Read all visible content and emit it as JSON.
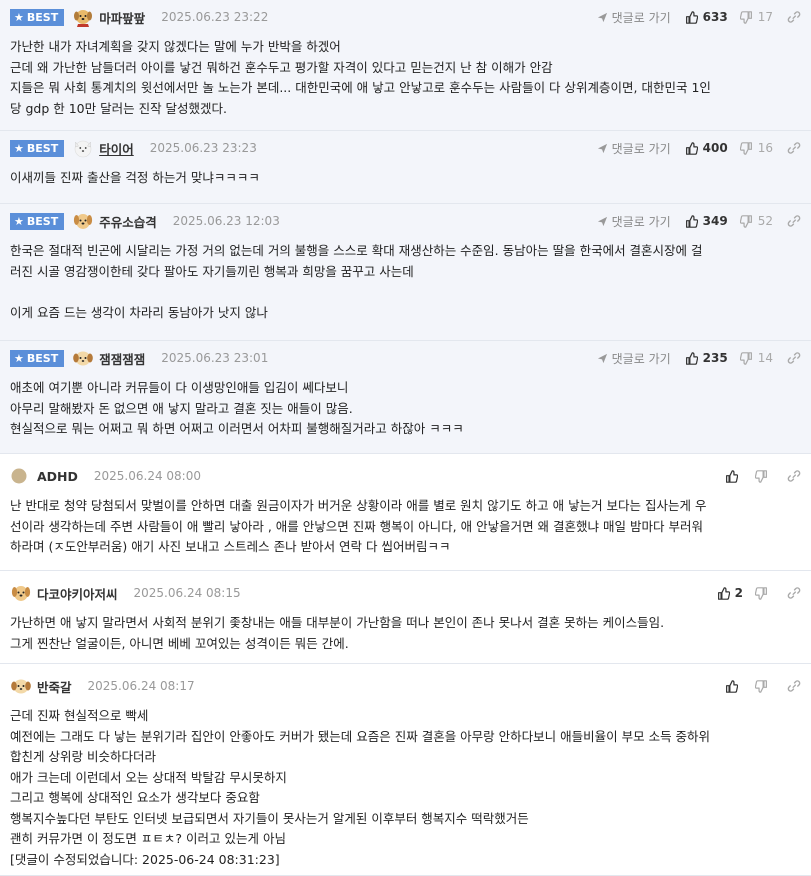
{
  "labels": {
    "best": "BEST",
    "reply": "댓글로 가기"
  },
  "comments": [
    {
      "best": true,
      "avatar": "puppy-santa-avatar",
      "nick": "마파팦팦",
      "date": "2025.06.23 23:22",
      "up": "633",
      "down": "17",
      "lines": [
        "가난한 내가 자녀계획을 갖지 않겠다는 말에 누가 반박을 하겠어",
        "근데 왜 가난한 남들더러 아이를 낳건 뭐하건 훈수두고 평가할 자격이 있다고 믿는건지 난 참 이해가 안감",
        "지들은 뭐 사회 통계치의 윗선에서만 놀 노는가 본데... 대한민국에 애 낳고 안낳고로 훈수두는 사람들이 다 상위계층이면, 대한민국 1인",
        "당 gdp 한 10만 달러는 진작 달성했겠다."
      ]
    },
    {
      "best": true,
      "avatar": "white-dog-avatar",
      "nick": "타이어",
      "date": "2025.06.23 23:23",
      "up": "400",
      "down": "16",
      "lines": [
        "이새끼들 진짜 출산을 걱정 하는거 맞냐ㅋㅋㅋㅋ"
      ]
    },
    {
      "best": true,
      "avatar": "puppy-avatar",
      "nick": "주유소습격",
      "date": "2025.06.23 12:03",
      "up": "349",
      "down": "52",
      "lines": [
        "한국은 절대적 빈곤에 시달리는 가정 거의 없는데 거의 불행을 스스로 확대 재생산하는 수준임. 동남아는 딸을 한국에서 결혼시장에 걸",
        "러진 시골 영감쟁이한테 갖다 팔아도 자기들끼린 행복과 희망을 꿈꾸고 사는데",
        "",
        "이게 요즘 드는 생각이 차라리 동남아가 낫지 않나"
      ]
    },
    {
      "best": true,
      "avatar": "puppy-face-avatar",
      "nick": "잼잼잼잼",
      "date": "2025.06.23 23:01",
      "up": "235",
      "down": "14",
      "lines": [
        "애초에 여기뿐 아니라 커뮤들이 다 이생망인애들 입김이 쎄다보니",
        "아무리 말해봤자 돈 없으면 애 낳지 말라고 결혼 짓는 애들이 많음.",
        "현실적으로 뭐는 어쩌고 뭐 하면 어쩌고 이러면서 어차피 불행해질거라고 하잖아 ㅋㅋㅋ"
      ]
    },
    {
      "best": false,
      "avatar": "default-circle-avatar",
      "nick": "ADHD",
      "date": "2025.06.24 08:00",
      "up": "",
      "down": "",
      "lines": [
        "난 반대로 청약 당첨되서 맞벌이를 안하면 대출 원금이자가 버거운 상황이라 애를 별로 원치 않기도 하고 애 낳는거 보다는 집사는게 우",
        "선이라 생각하는데 주변 사람들이 애 빨리 낳아라 , 애를 안낳으면 진짜 행복이 아니다, 애 안낳을거면 왜 결혼했냐 매일 밤마다 부러워",
        "하라며 (ㅈ도안부러움) 애기 사진 보내고 스트레스 존나 받아서 연락 다 씹어버림ㅋㅋ"
      ]
    },
    {
      "best": false,
      "avatar": "puppy-avatar",
      "nick": "다코야키아저씨",
      "date": "2025.06.24 08:15",
      "up": "2",
      "down": "",
      "lines": [
        "가난하면 애 낳지 말라면서 사회적 분위기 좇창내는 애들 대부분이 가난함을 떠나 본인이 존나 못나서 결혼 못하는 케이스들임.",
        "그게 찐찬난 얼굴이든, 아니면 베베 꼬여있는 성격이든 뭐든 간에."
      ]
    },
    {
      "best": false,
      "avatar": "puppy-face-avatar",
      "nick": "반죽갈",
      "date": "2025.06.24 08:17",
      "up": "",
      "down": "",
      "lines": [
        "근데 진짜 현실적으로 빡세",
        "예전에는 그래도 다 낳는 분위기라 집안이 안좋아도 커버가 됐는데 요즘은 진짜 결혼을 아무랑 안하다보니 애들비율이 부모 소득 중하위",
        "합친게 상위랑 비슷하다더라",
        "애가 크는데 이런데서 오는 상대적 박탈감 무시못하지",
        "그리고 행복에 상대적인 요소가 생각보다 중요함",
        "행복지수높다던 부탄도 인터넷 보급되면서 자기들이 못사는거 알게된 이후부터 행복지수 떡락했거든",
        "괜히 커뮤가면 이 정도면 ㅍㅌㅊ? 이러고 있는게 아님",
        "[댓글이 수정되었습니다: 2025-06-24 08:31:23]"
      ]
    }
  ]
}
